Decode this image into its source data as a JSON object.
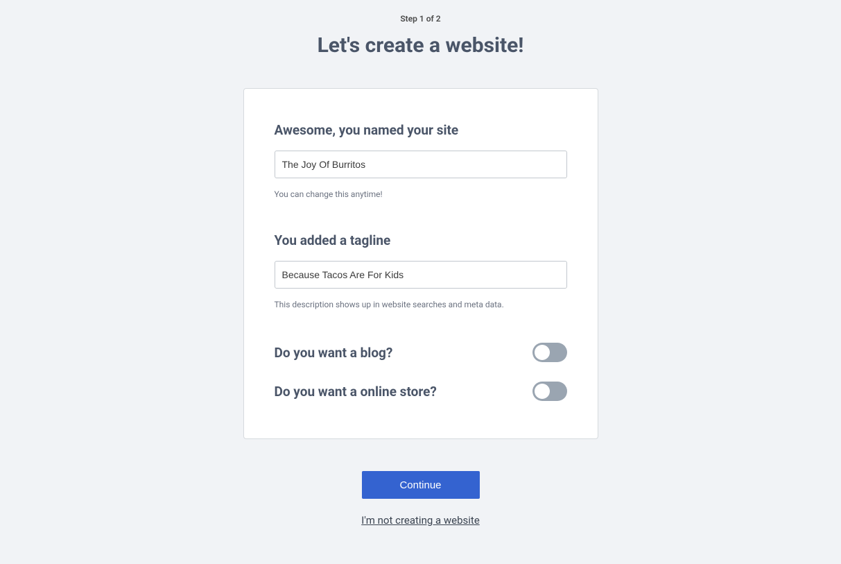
{
  "header": {
    "step": "Step 1 of 2",
    "title": "Let's create a website!"
  },
  "form": {
    "siteName": {
      "heading": "Awesome, you named your site",
      "value": "The Joy Of Burritos",
      "helper": "You can change this anytime!"
    },
    "tagline": {
      "heading": "You added a tagline",
      "value": "Because Tacos Are For Kids",
      "helper": "This description shows up in website searches and meta data."
    },
    "blog": {
      "label": "Do you want a blog?",
      "value": false
    },
    "store": {
      "label": "Do you want a online store?",
      "value": false
    }
  },
  "actions": {
    "continue": "Continue",
    "skip": "I'm not creating a website"
  }
}
